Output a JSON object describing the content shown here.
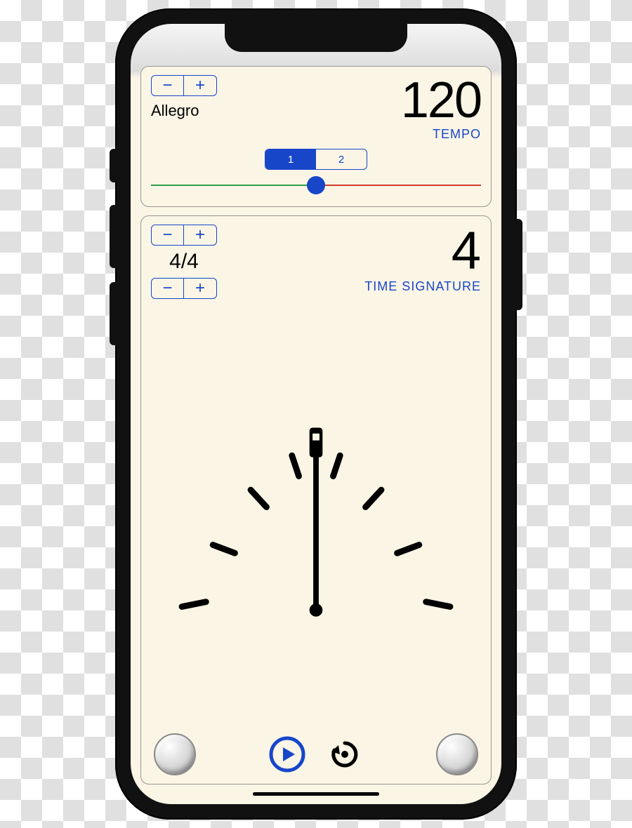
{
  "tempo": {
    "minus": "−",
    "plus": "+",
    "name": "Allegro",
    "value": "120",
    "label": "TEMPO",
    "segments": {
      "one": "1",
      "two": "2",
      "active": 1
    }
  },
  "time_signature": {
    "top_minus": "−",
    "top_plus": "+",
    "text": "4/4",
    "bottom_minus": "−",
    "bottom_plus": "+",
    "beat": "4",
    "label": "TIME SIGNATURE"
  },
  "colors": {
    "accent": "#1746c9",
    "track_left": "#2e9e4a",
    "track_right": "#d03a2a",
    "card_bg": "#FBF5E6"
  }
}
